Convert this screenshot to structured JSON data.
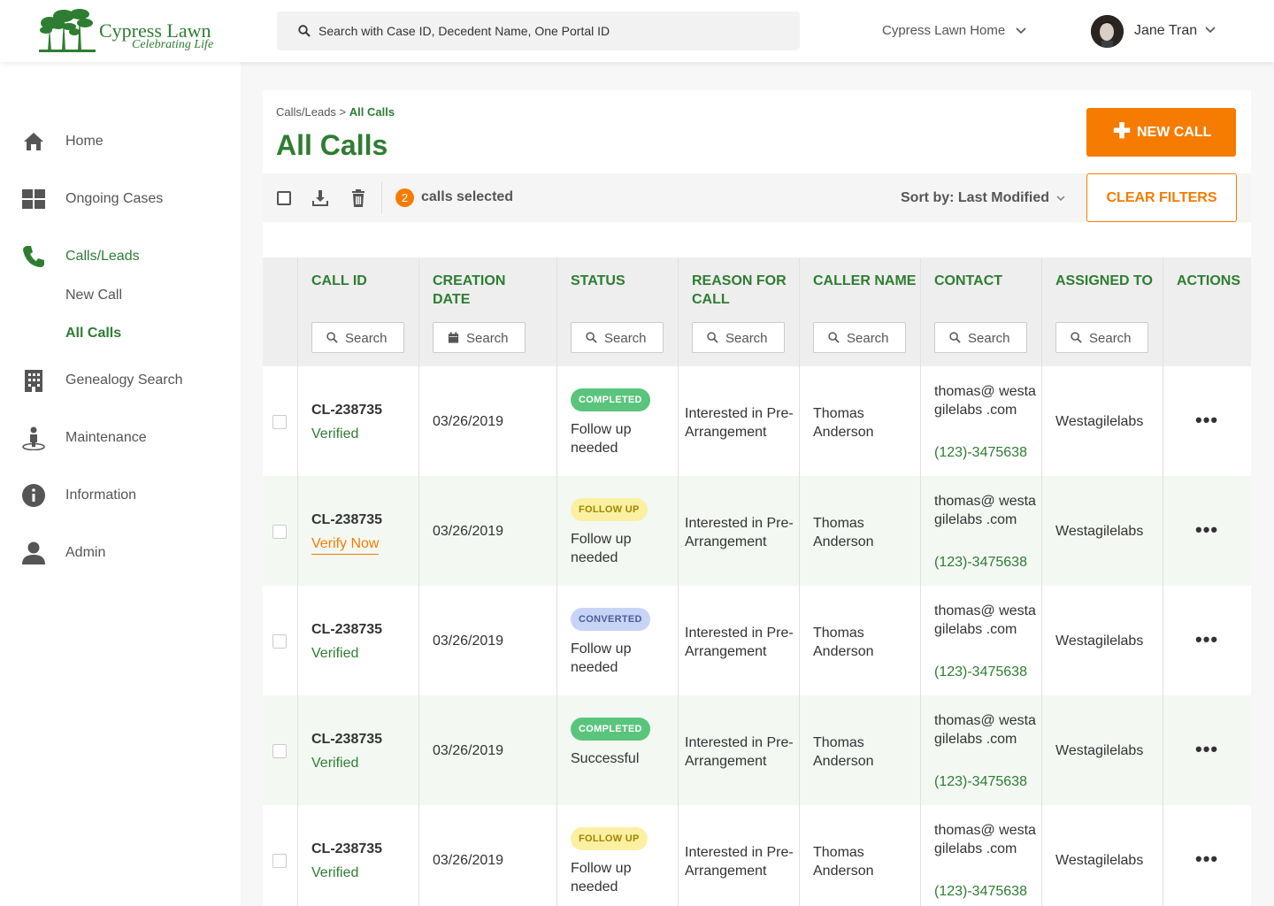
{
  "header": {
    "logo_name": "Cypress Lawn",
    "logo_tagline": "Celebrating Life",
    "search_placeholder": "Search with Case ID, Decedent Name, One Portal ID",
    "location": "Cypress Lawn Home",
    "user_name": "Jane Tran"
  },
  "sidebar": {
    "items": [
      {
        "label": "Home",
        "icon": "home-icon"
      },
      {
        "label": "Ongoing Cases",
        "icon": "dashboard-icon"
      },
      {
        "label": "Calls/Leads",
        "icon": "phone-icon"
      },
      {
        "label": "Genealogy Search",
        "icon": "building-icon"
      },
      {
        "label": "Maintenance",
        "icon": "person-pin-icon"
      },
      {
        "label": "Information",
        "icon": "info-icon"
      },
      {
        "label": "Admin",
        "icon": "user-icon"
      }
    ],
    "sub_items": [
      {
        "label": "New Call"
      },
      {
        "label": "All Calls"
      }
    ]
  },
  "page": {
    "breadcrumb_parent": "Calls/Leads",
    "breadcrumb_sep": " > ",
    "breadcrumb_current": "All Calls",
    "title": "All Calls",
    "new_call_label": "NEW CALL",
    "clear_filters_label": "CLEAR FILTERS"
  },
  "toolbar": {
    "selected_count": "2",
    "selected_label": "calls selected",
    "sort_label": "Sort by: Last Modified"
  },
  "table": {
    "columns": [
      {
        "label": "CALL ID",
        "filter": "Search"
      },
      {
        "label": "CREATION DATE",
        "filter": "Search"
      },
      {
        "label": "STATUS",
        "filter": "Search"
      },
      {
        "label": "REASON FOR CALL",
        "filter": "Search"
      },
      {
        "label": "CALLER NAME",
        "filter": "Search"
      },
      {
        "label": "CONTACT",
        "filter": "Search"
      },
      {
        "label": "ASSIGNED TO",
        "filter": "Search"
      },
      {
        "label": "ACTIONS",
        "filter": ""
      }
    ],
    "rows": [
      {
        "call_id": "CL-238735",
        "verification": "Verified",
        "date": "03/26/2019",
        "status": "COMPLETED",
        "status_text": "Follow up needed",
        "reason": "Interested in Pre-Arrangement",
        "caller": "Thomas Anderson",
        "email": "thomas@ westagilelabs .com",
        "phone": "(123)-3475638",
        "assigned": "Westagilelabs",
        "actions": "•••"
      },
      {
        "call_id": "CL-238735",
        "verification": "Verify Now",
        "date": "03/26/2019",
        "status": "FOLLOW UP",
        "status_text": "Follow up needed",
        "reason": "Interested in Pre-Arrangement",
        "caller": "Thomas Anderson",
        "email": "thomas@ westagilelabs .com",
        "phone": "(123)-3475638",
        "assigned": "Westagilelabs",
        "actions": "•••"
      },
      {
        "call_id": "CL-238735",
        "verification": "Verified",
        "date": "03/26/2019",
        "status": "CONVERTED",
        "status_text": "Follow up needed",
        "reason": "Interested in Pre-Arrangement",
        "caller": "Thomas Anderson",
        "email": "thomas@ westagilelabs .com",
        "phone": "(123)-3475638",
        "assigned": "Westagilelabs",
        "actions": "•••"
      },
      {
        "call_id": "CL-238735",
        "verification": "Verified",
        "date": "03/26/2019",
        "status": "COMPLETED",
        "status_text": "Successful",
        "reason": "Interested in Pre-Arrangement",
        "caller": "Thomas Anderson",
        "email": "thomas@ westagilelabs .com",
        "phone": "(123)-3475638",
        "assigned": "Westagilelabs",
        "actions": "•••"
      },
      {
        "call_id": "CL-238735",
        "verification": "Verified",
        "date": "03/26/2019",
        "status": "FOLLOW UP",
        "status_text": "Follow up needed",
        "reason": "Interested in Pre-Arrangement",
        "caller": "Thomas Anderson",
        "email": "thomas@ westagilelabs .com",
        "phone": "(123)-3475638",
        "assigned": "Westagilelabs",
        "actions": "•••"
      }
    ]
  },
  "colors": {
    "brand_green": "#2e7d32",
    "accent_orange": "#f57c00"
  }
}
